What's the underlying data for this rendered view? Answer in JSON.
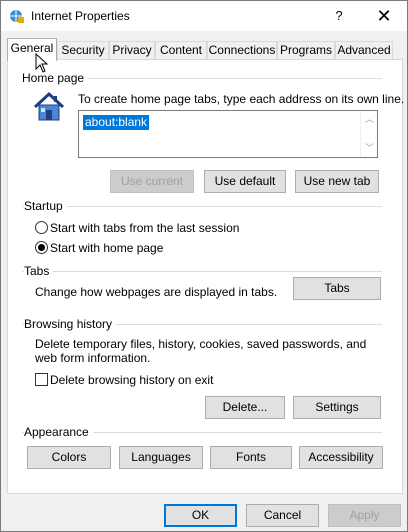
{
  "window": {
    "title": "Internet Properties",
    "help_label": "?",
    "close_label": "✕"
  },
  "tabs": [
    {
      "label": "General",
      "active": true
    },
    {
      "label": "Security"
    },
    {
      "label": "Privacy"
    },
    {
      "label": "Content"
    },
    {
      "label": "Connections"
    },
    {
      "label": "Programs"
    },
    {
      "label": "Advanced"
    }
  ],
  "home_page": {
    "section_label": "Home page",
    "instructions": "To create home page tabs, type each address on its own line.",
    "value": "about:blank",
    "use_current_label": "Use current",
    "use_default_label": "Use default",
    "use_new_tab_label": "Use new tab"
  },
  "startup": {
    "section_label": "Startup",
    "option_last_session": "Start with tabs from the last session",
    "option_home_page": "Start with home page",
    "selected": "home_page"
  },
  "tabs_section": {
    "section_label": "Tabs",
    "description": "Change how webpages are displayed in tabs.",
    "button_label": "Tabs"
  },
  "browsing_history": {
    "section_label": "Browsing history",
    "description": "Delete temporary files, history, cookies, saved passwords, and web form information.",
    "delete_on_exit_label": "Delete browsing history on exit",
    "delete_on_exit_checked": false,
    "delete_label": "Delete...",
    "settings_label": "Settings"
  },
  "appearance": {
    "section_label": "Appearance",
    "colors_label": "Colors",
    "languages_label": "Languages",
    "fonts_label": "Fonts",
    "accessibility_label": "Accessibility"
  },
  "footer": {
    "ok_label": "OK",
    "cancel_label": "Cancel",
    "apply_label": "Apply"
  },
  "colors": {
    "accent": "#0078d7",
    "house": "#2f5fb0"
  }
}
